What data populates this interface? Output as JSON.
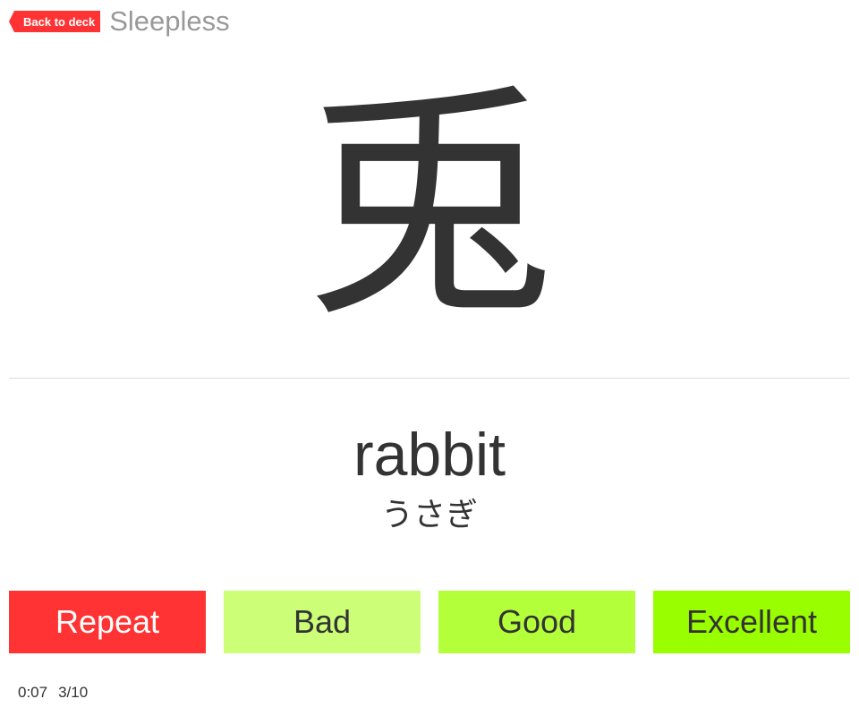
{
  "header": {
    "back_label": "Back to deck",
    "deck_title": "Sleepless"
  },
  "card": {
    "kanji": "兎",
    "meaning": "rabbit",
    "reading": "うさぎ"
  },
  "grades": {
    "repeat": "Repeat",
    "bad": "Bad",
    "good": "Good",
    "excellent": "Excellent"
  },
  "colors": {
    "repeat": "#ff3333",
    "bad": "#ccff77",
    "good": "#b3ff3a",
    "excellent": "#99ff00",
    "back_button": "#ff3333"
  },
  "footer": {
    "timer": "0:07",
    "progress": "3/10"
  }
}
